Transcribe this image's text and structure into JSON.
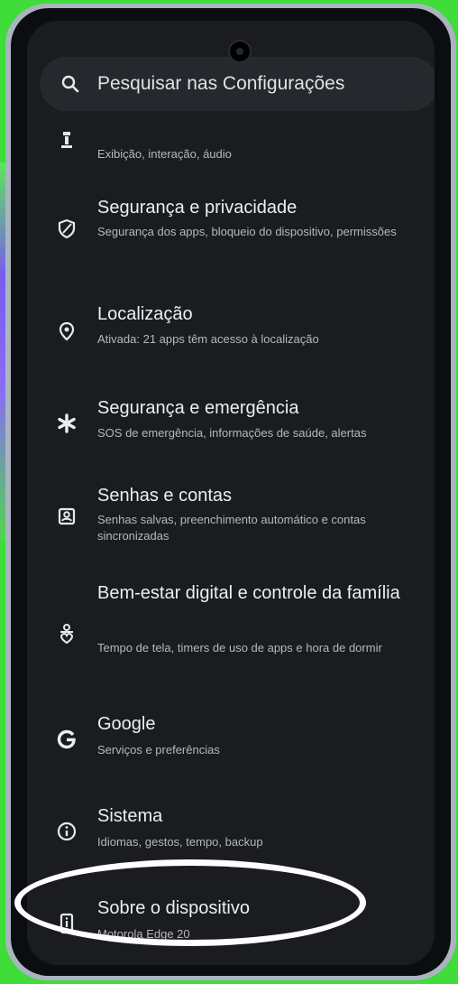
{
  "search": {
    "label": "Pesquisar nas Configurações",
    "icon": "search-icon"
  },
  "items": [
    {
      "id": "exibicao",
      "title": "",
      "subtitle": "Exibição, interação, áudio",
      "icon": "accessibility-icon"
    },
    {
      "id": "seguranca-privacidade",
      "title": "Segurança e privacidade",
      "subtitle": "Segurança dos apps, bloqueio do dispositivo, permissões",
      "icon": "shield-icon"
    },
    {
      "id": "localizacao",
      "title": "Localização",
      "subtitle": "Ativada: 21 apps têm acesso à localização",
      "icon": "location-pin-icon"
    },
    {
      "id": "seguranca-emergencia",
      "title": "Segurança e emergência",
      "subtitle": "SOS de emergência, informações de saúde, alertas",
      "icon": "asterisk-icon"
    },
    {
      "id": "senhas-contas",
      "title": "Senhas e contas",
      "subtitle": "Senhas salvas, preenchimento automático e contas sincronizadas",
      "icon": "account-box-icon"
    },
    {
      "id": "bem-estar",
      "title": "Bem-estar digital e controle da família",
      "subtitle": "Tempo de tela, timers de uso de apps e hora de dormir",
      "icon": "wellbeing-icon"
    },
    {
      "id": "google",
      "title": "Google",
      "subtitle": "Serviços e preferências",
      "icon": "google-g-icon"
    },
    {
      "id": "sistema",
      "title": "Sistema",
      "subtitle": "Idiomas, gestos, tempo, backup",
      "icon": "info-icon"
    },
    {
      "id": "sobre",
      "title": "Sobre o dispositivo",
      "subtitle": "Motorola Edge 20",
      "icon": "phone-device-icon"
    }
  ],
  "colors": {
    "screen_bg": "#1a1c20",
    "highlight": "#ffffff",
    "background": "#3fdc3a"
  }
}
